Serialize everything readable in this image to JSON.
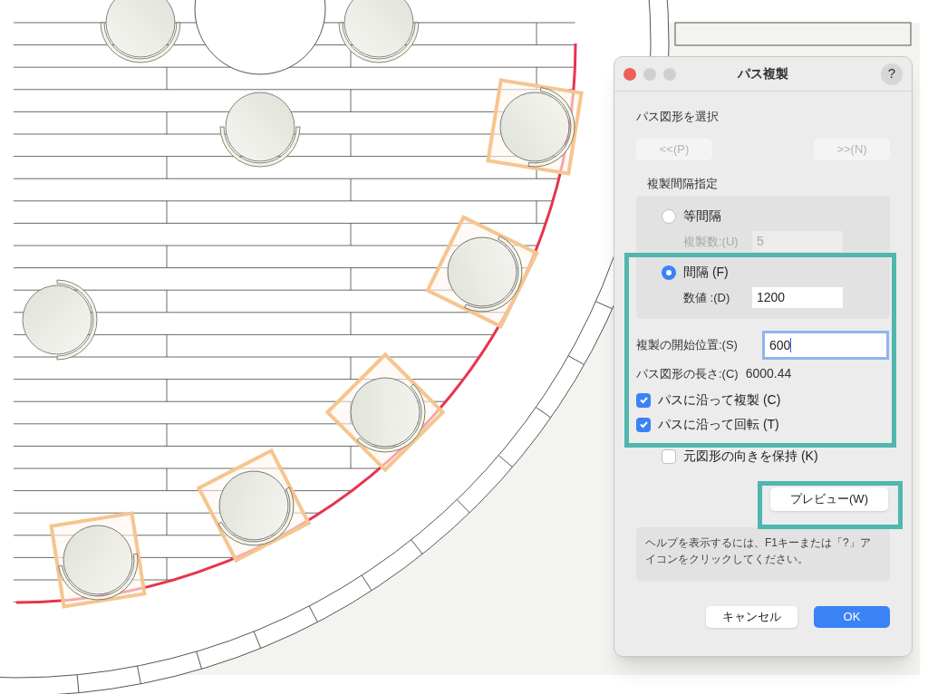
{
  "window": {
    "title": "パス複製",
    "help_button": "?"
  },
  "path_select": {
    "label": "パス図形を選択",
    "prev_button": {
      "label": "<<(P)",
      "disabled": true
    },
    "next_button": {
      "label": ">>(N)",
      "disabled": true
    }
  },
  "spacing": {
    "label": "複製間隔指定",
    "options": [
      {
        "label": "等間隔",
        "selected": false,
        "field": {
          "label": "複製数:(U)",
          "value": "5",
          "disabled": true
        }
      },
      {
        "label": "間隔 (F)",
        "selected": true,
        "field": {
          "label": "数値 :(D)",
          "value": "1200",
          "disabled": false
        }
      }
    ]
  },
  "start": {
    "label": "複製の開始位置:(S)",
    "value": "600",
    "focused": true
  },
  "length": {
    "label": "パス図形の長さ:(C)",
    "value": "6000.44"
  },
  "checkboxes": [
    {
      "label": "パスに沿って複製 (C)",
      "checked": true,
      "indented": false
    },
    {
      "label": "パスに沿って回転 (T)",
      "checked": true,
      "indented": false
    },
    {
      "label": "元図形の向きを保持 (K)",
      "checked": false,
      "indented": true
    }
  ],
  "preview_button": "プレビュー(W)",
  "help_text": "ヘルプを表示するには、F1キーまたは「?」アイコンをクリックしてください。",
  "buttons": [
    {
      "label": "キャンセル",
      "kind": "secondary"
    },
    {
      "label": "OK",
      "kind": "primary"
    }
  ]
}
